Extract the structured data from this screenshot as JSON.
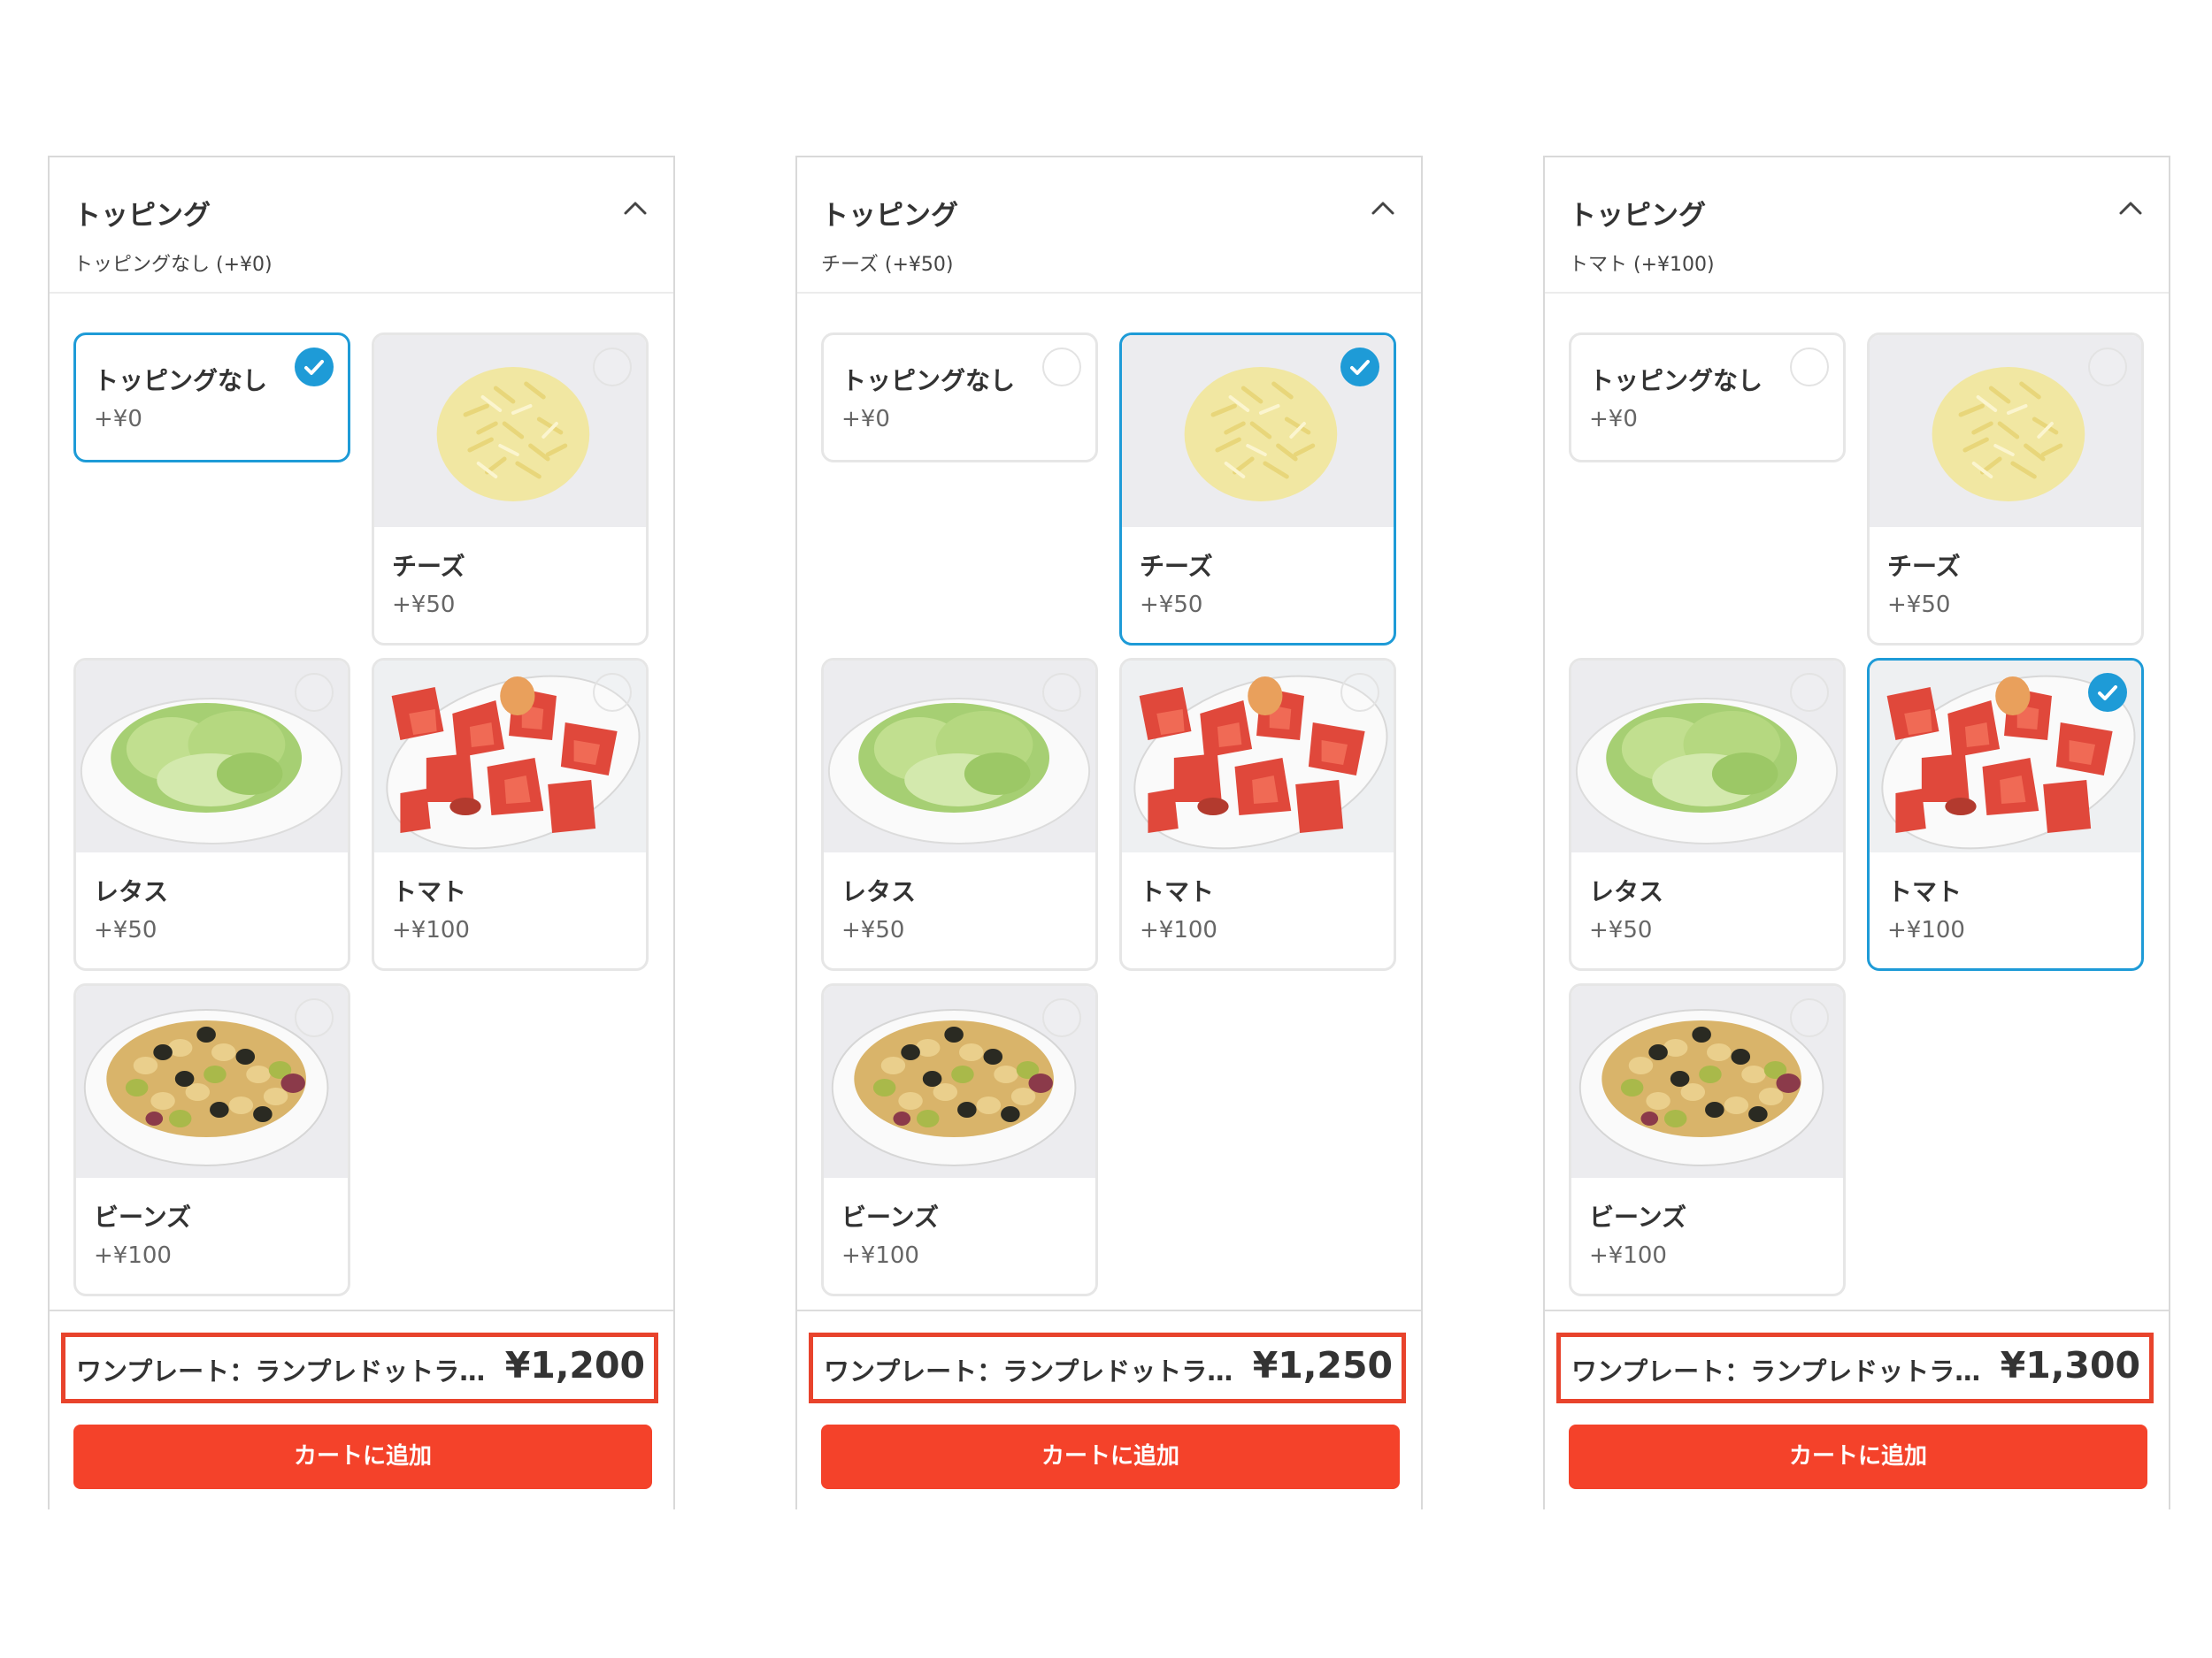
{
  "colors": {
    "accent": "#1e9bd7",
    "cart_button": "#f4422a",
    "highlight_border": "#e8432c"
  },
  "panels": [
    {
      "title": "トッピング",
      "subtitle": "トッピングなし (+¥0)",
      "options": [
        {
          "name": "トッピングなし",
          "price": "+¥0",
          "image": "",
          "selected": true
        },
        {
          "name": "チーズ",
          "price": "+¥50",
          "image": "cheese",
          "selected": false
        },
        {
          "name": "レタス",
          "price": "+¥50",
          "image": "lettuce",
          "selected": false
        },
        {
          "name": "トマト",
          "price": "+¥100",
          "image": "tomato",
          "selected": false
        },
        {
          "name": "ビーンズ",
          "price": "+¥100",
          "image": "beans",
          "selected": false
        }
      ],
      "summary_name": "ワンプレート：ランプレドットラ…",
      "summary_price": "¥1,200",
      "cart_label": "カートに追加"
    },
    {
      "title": "トッピング",
      "subtitle": "チーズ (+¥50)",
      "options": [
        {
          "name": "トッピングなし",
          "price": "+¥0",
          "image": "",
          "selected": false
        },
        {
          "name": "チーズ",
          "price": "+¥50",
          "image": "cheese",
          "selected": true
        },
        {
          "name": "レタス",
          "price": "+¥50",
          "image": "lettuce",
          "selected": false
        },
        {
          "name": "トマト",
          "price": "+¥100",
          "image": "tomato",
          "selected": false
        },
        {
          "name": "ビーンズ",
          "price": "+¥100",
          "image": "beans",
          "selected": false
        }
      ],
      "summary_name": "ワンプレート：ランプレドットラ…",
      "summary_price": "¥1,250",
      "cart_label": "カートに追加"
    },
    {
      "title": "トッピング",
      "subtitle": "トマト (+¥100)",
      "options": [
        {
          "name": "トッピングなし",
          "price": "+¥0",
          "image": "",
          "selected": false
        },
        {
          "name": "チーズ",
          "price": "+¥50",
          "image": "cheese",
          "selected": false
        },
        {
          "name": "レタス",
          "price": "+¥50",
          "image": "lettuce",
          "selected": false
        },
        {
          "name": "トマト",
          "price": "+¥100",
          "image": "tomato",
          "selected": true
        },
        {
          "name": "ビーンズ",
          "price": "+¥100",
          "image": "beans",
          "selected": false
        }
      ],
      "summary_name": "ワンプレート：ランプレドットラ…",
      "summary_price": "¥1,300",
      "cart_label": "カートに追加"
    }
  ]
}
